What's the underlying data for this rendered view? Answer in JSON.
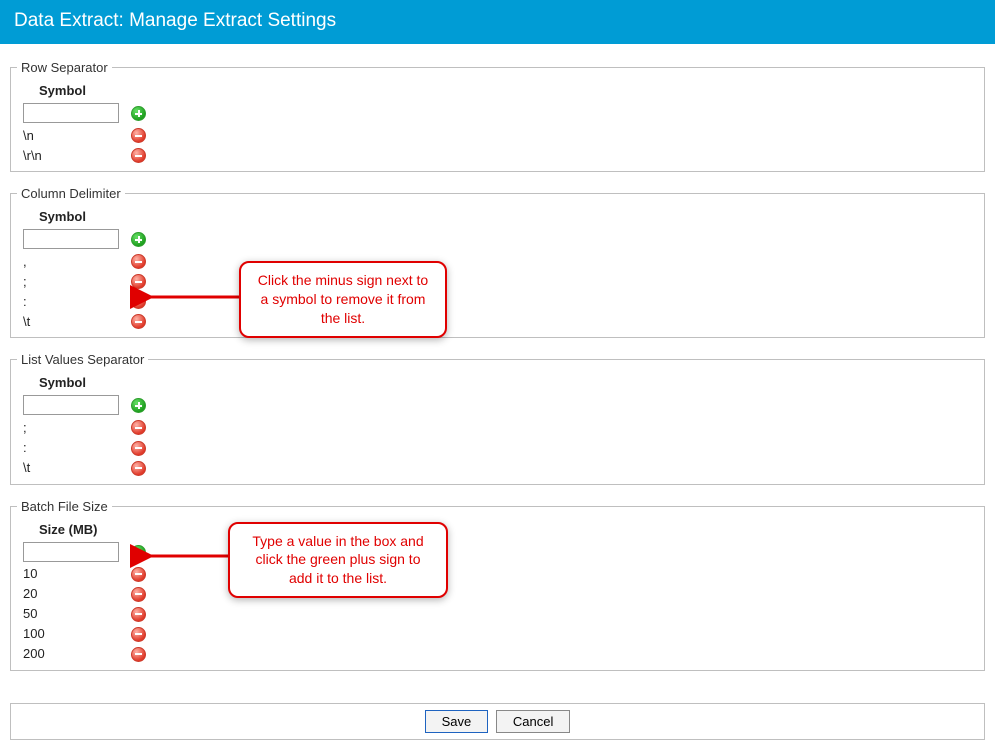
{
  "header": {
    "title": "Data Extract: Manage Extract Settings"
  },
  "sections": {
    "row_separator": {
      "legend": "Row Separator",
      "col_header": "Symbol",
      "input_value": "",
      "items": [
        "\\n",
        "\\r\\n"
      ]
    },
    "column_delimiter": {
      "legend": "Column Delimiter",
      "col_header": "Symbol",
      "input_value": "",
      "items": [
        ",",
        ";",
        ":",
        "\\t"
      ]
    },
    "list_values_separator": {
      "legend": "List Values Separator",
      "col_header": "Symbol",
      "input_value": "",
      "items": [
        ";",
        ":",
        "\\t"
      ]
    },
    "batch_file_size": {
      "legend": "Batch File Size",
      "col_header": "Size (MB)",
      "input_value": "",
      "items": [
        "10",
        "20",
        "50",
        "100",
        "200"
      ]
    }
  },
  "callouts": {
    "remove": "Click the minus sign next to a symbol to remove it from the list.",
    "add": "Type a value in the box and click the green plus sign to add it to the list."
  },
  "footer": {
    "save": "Save",
    "cancel": "Cancel"
  }
}
